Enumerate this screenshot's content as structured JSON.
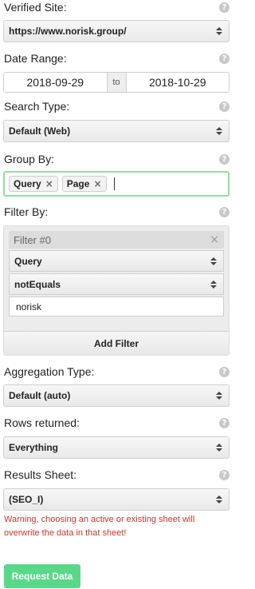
{
  "verified_site": {
    "label": "Verified Site:",
    "value": "https://www.norisk.group/"
  },
  "date_range": {
    "label": "Date Range:",
    "start": "2018-09-29",
    "separator": "to",
    "end": "2018-10-29"
  },
  "search_type": {
    "label": "Search Type:",
    "value": "Default (Web)"
  },
  "group_by": {
    "label": "Group By:",
    "tags": [
      "Query",
      "Page"
    ],
    "remove_glyph": "×"
  },
  "filter_by": {
    "label": "Filter By:",
    "filter_title": "Filter #0",
    "close_glyph": "×",
    "dimension": "Query",
    "operator": "notEquals",
    "expression": "norisk",
    "add_filter": "Add Filter"
  },
  "aggregation_type": {
    "label": "Aggregation Type:",
    "value": "Default (auto)"
  },
  "rows_returned": {
    "label": "Rows returned:",
    "value": "Everything"
  },
  "results_sheet": {
    "label": "Results Sheet:",
    "value": "(SEO_I)"
  },
  "warning": "Warning, choosing an active or existing sheet will overwrite the data in that sheet!",
  "request_button": "Request Data",
  "help_glyph": "?",
  "colors": {
    "accent_green": "#5ad88a",
    "focus_green": "#8fe0a2",
    "warning_red": "#c0392b"
  }
}
